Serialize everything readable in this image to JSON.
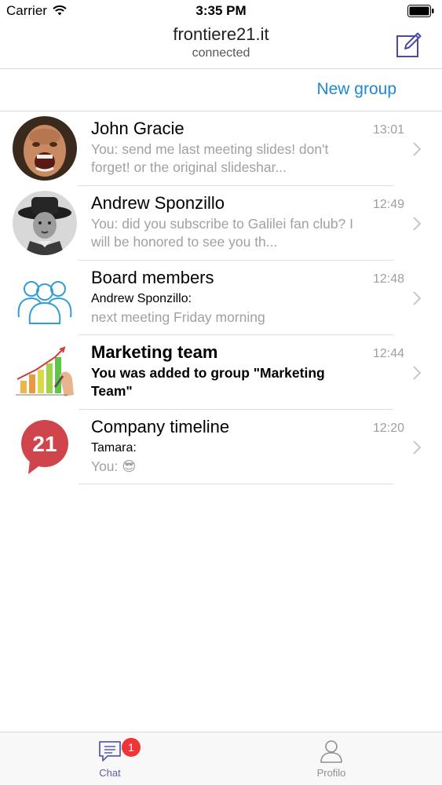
{
  "status_bar": {
    "carrier": "Carrier",
    "time": "3:35 PM"
  },
  "header": {
    "title": "frontiere21.it",
    "subtitle": "connected",
    "compose_icon": "compose-icon"
  },
  "toolbar": {
    "new_group_label": "New group"
  },
  "chats": [
    {
      "name": "John Gracie",
      "time": "13:01",
      "preview": "You: send me last meeting slides! don't forget! or the original slideshar...",
      "avatar": "photo-avatar"
    },
    {
      "name": "Andrew Sponzillo",
      "time": "12:49",
      "preview": "You: did you subscribe to Galilei fan club? I will be honored to see you th...",
      "avatar": "photo-avatar"
    },
    {
      "name": "Board members",
      "time": "12:48",
      "sender": "Andrew Sponzillo:",
      "preview": "next meeting Friday morning",
      "avatar": "group-icon"
    },
    {
      "name": "Marketing team",
      "time": "12:44",
      "preview": "You was added to group \"Marketing Team\"",
      "avatar": "chart-drawing-icon"
    },
    {
      "name": "Company timeline",
      "time": "12:20",
      "sender": "Tamara:",
      "preview": "You: 😎",
      "avatar": "speech-bubble-21-icon",
      "avatar_text": "21"
    }
  ],
  "tabs": [
    {
      "label": "Chat",
      "icon": "chat-bubble-icon",
      "badge": "1",
      "active": true
    },
    {
      "label": "Profilo",
      "icon": "person-icon",
      "active": false
    }
  ],
  "colors": {
    "accent": "#1e88d3",
    "tab_active": "#5b5ea6",
    "badge": "#ef3535",
    "secondary_text": "#a0a0a5"
  }
}
